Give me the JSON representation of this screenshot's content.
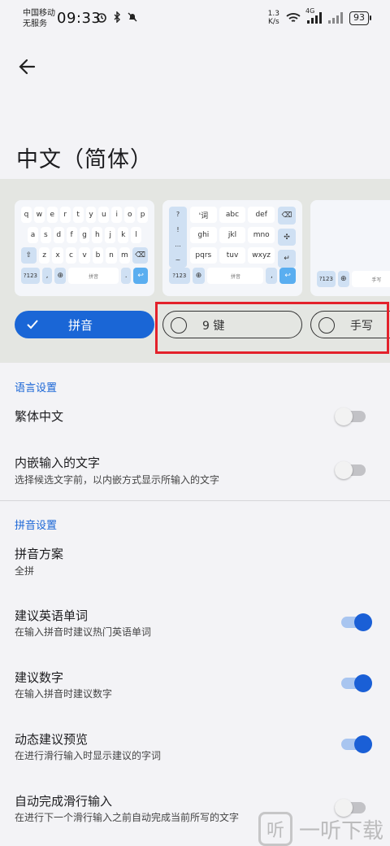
{
  "status_bar": {
    "carrier_line1": "中国移动",
    "carrier_line2": "无服务",
    "time": "09:33",
    "net_speed_value": "1.3",
    "net_speed_unit": "K/s",
    "network_type": "4G",
    "battery": "93",
    "icons": [
      "alarm-icon",
      "bluetooth-icon",
      "mute-icon",
      "wifi-icon",
      "signal-icon",
      "battery-icon"
    ]
  },
  "page": {
    "title": "中文（简体）"
  },
  "keyboard_previews": {
    "qwerty": {
      "rows": [
        [
          "q",
          "w",
          "e",
          "r",
          "t",
          "y",
          "u",
          "i",
          "o",
          "p"
        ],
        [
          "a",
          "s",
          "d",
          "f",
          "g",
          "h",
          "j",
          "k",
          "l"
        ],
        [
          "z",
          "x",
          "c",
          "v",
          "b",
          "n",
          "m"
        ]
      ],
      "symbols_key": "?123",
      "space_label": "拼音"
    },
    "nine_key": {
      "side_keys": [
        "?",
        "!",
        "...",
        "~"
      ],
      "rows": [
        [
          "'词",
          "abc",
          "def"
        ],
        [
          "ghi",
          "jkl",
          "mno"
        ],
        [
          "pqrs",
          "tuv",
          "wxyz"
        ]
      ],
      "symbols_key": "?123",
      "space_label": "拼音"
    },
    "handwriting": {
      "symbols_key": "?123",
      "space_label": "手写"
    }
  },
  "layouts": {
    "pinyin_label": "拼音",
    "nine_key_label": "9 键",
    "handwriting_label": "手写",
    "selected": "pinyin"
  },
  "sections": {
    "language": {
      "header": "语言设置",
      "items": [
        {
          "title": "繁体中文",
          "subtitle": "",
          "on": false
        },
        {
          "title": "内嵌输入的文字",
          "subtitle": "选择候选文字前，以内嵌方式显示所输入的文字",
          "on": false
        }
      ]
    },
    "pinyin": {
      "header": "拼音设置",
      "scheme": {
        "title": "拼音方案",
        "subtitle": "全拼"
      },
      "items": [
        {
          "title": "建议英语单词",
          "subtitle": "在输入拼音时建议热门英语单词",
          "on": true
        },
        {
          "title": "建议数字",
          "subtitle": "在输入拼音时建议数字",
          "on": true
        },
        {
          "title": "动态建议预览",
          "subtitle": "在进行滑行输入时显示建议的字词",
          "on": true
        },
        {
          "title": "自动完成滑行输入",
          "subtitle": "在进行下一个滑行输入之前自动完成当前所写的文字",
          "on": false
        }
      ]
    }
  },
  "watermark": {
    "logo": "听",
    "text": "一听下载"
  },
  "colors": {
    "accent": "#1a66d6",
    "highlight_box": "#e3212b"
  }
}
